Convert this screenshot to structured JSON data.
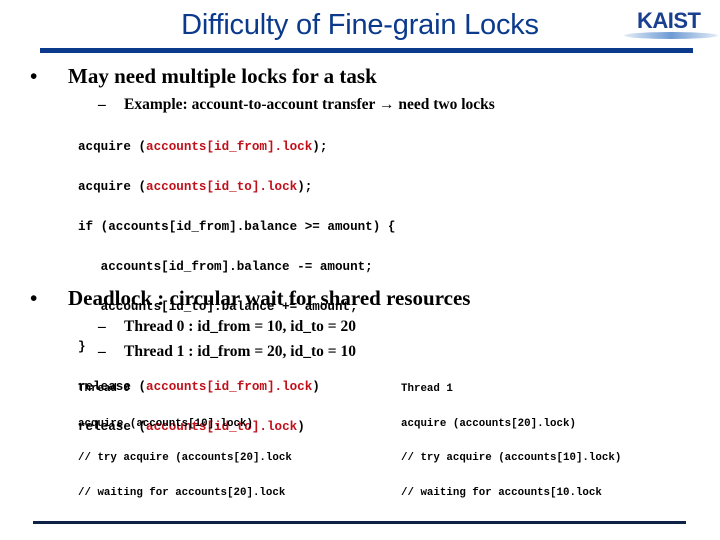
{
  "slide": {
    "title": "Difficulty of Fine-grain Locks",
    "logo_text": "KAIST",
    "accent_color": "#0b3a8c",
    "code_highlight_color": "#c0101a"
  },
  "bullets": [
    {
      "marker": "•",
      "text": "May need multiple locks for a task",
      "subitems": [
        {
          "marker": "–",
          "text": "Example: account-to-account transfer",
          "arrow": "→",
          "text_after": "need two locks"
        }
      ]
    },
    {
      "marker": "•",
      "text": "Deadlock : circular wait for shared resources",
      "subitems": [
        {
          "marker": "–",
          "text": "Thread 0 :  id_from = 10, id_to = 20"
        },
        {
          "marker": "–",
          "text": "Thread 1 :  id_from = 20, id_to = 10"
        }
      ]
    }
  ],
  "transfer_code": [
    {
      "pre": "acquire (",
      "hl": "accounts[id_from].lock",
      "post": ");"
    },
    {
      "pre": "acquire (",
      "hl": "accounts[id_to].lock",
      "post": ");"
    },
    {
      "pre": "if (accounts[id_from].balance >= amount) {",
      "hl": "",
      "post": ""
    },
    {
      "pre": "   accounts[id_from].balance -= amount;",
      "hl": "",
      "post": ""
    },
    {
      "pre": "   accounts[id_to].balance += amount;",
      "hl": "",
      "post": ""
    },
    {
      "pre": "}",
      "hl": "",
      "post": ""
    },
    {
      "pre": "release (",
      "hl": "accounts[id_from].lock",
      "post": ")"
    },
    {
      "pre": "release (",
      "hl": "accounts[id_to].lock",
      "post": ")"
    }
  ],
  "thread0_code": [
    "Thread 0",
    "acquire (accounts[10].lock)",
    "// try acquire (accounts[20].lock",
    "// waiting for accounts[20].lock"
  ],
  "thread1_code": [
    "Thread 1",
    "acquire (accounts[20].lock)",
    "// try acquire (accounts[10].lock)",
    "// waiting for accounts[10.lock"
  ]
}
